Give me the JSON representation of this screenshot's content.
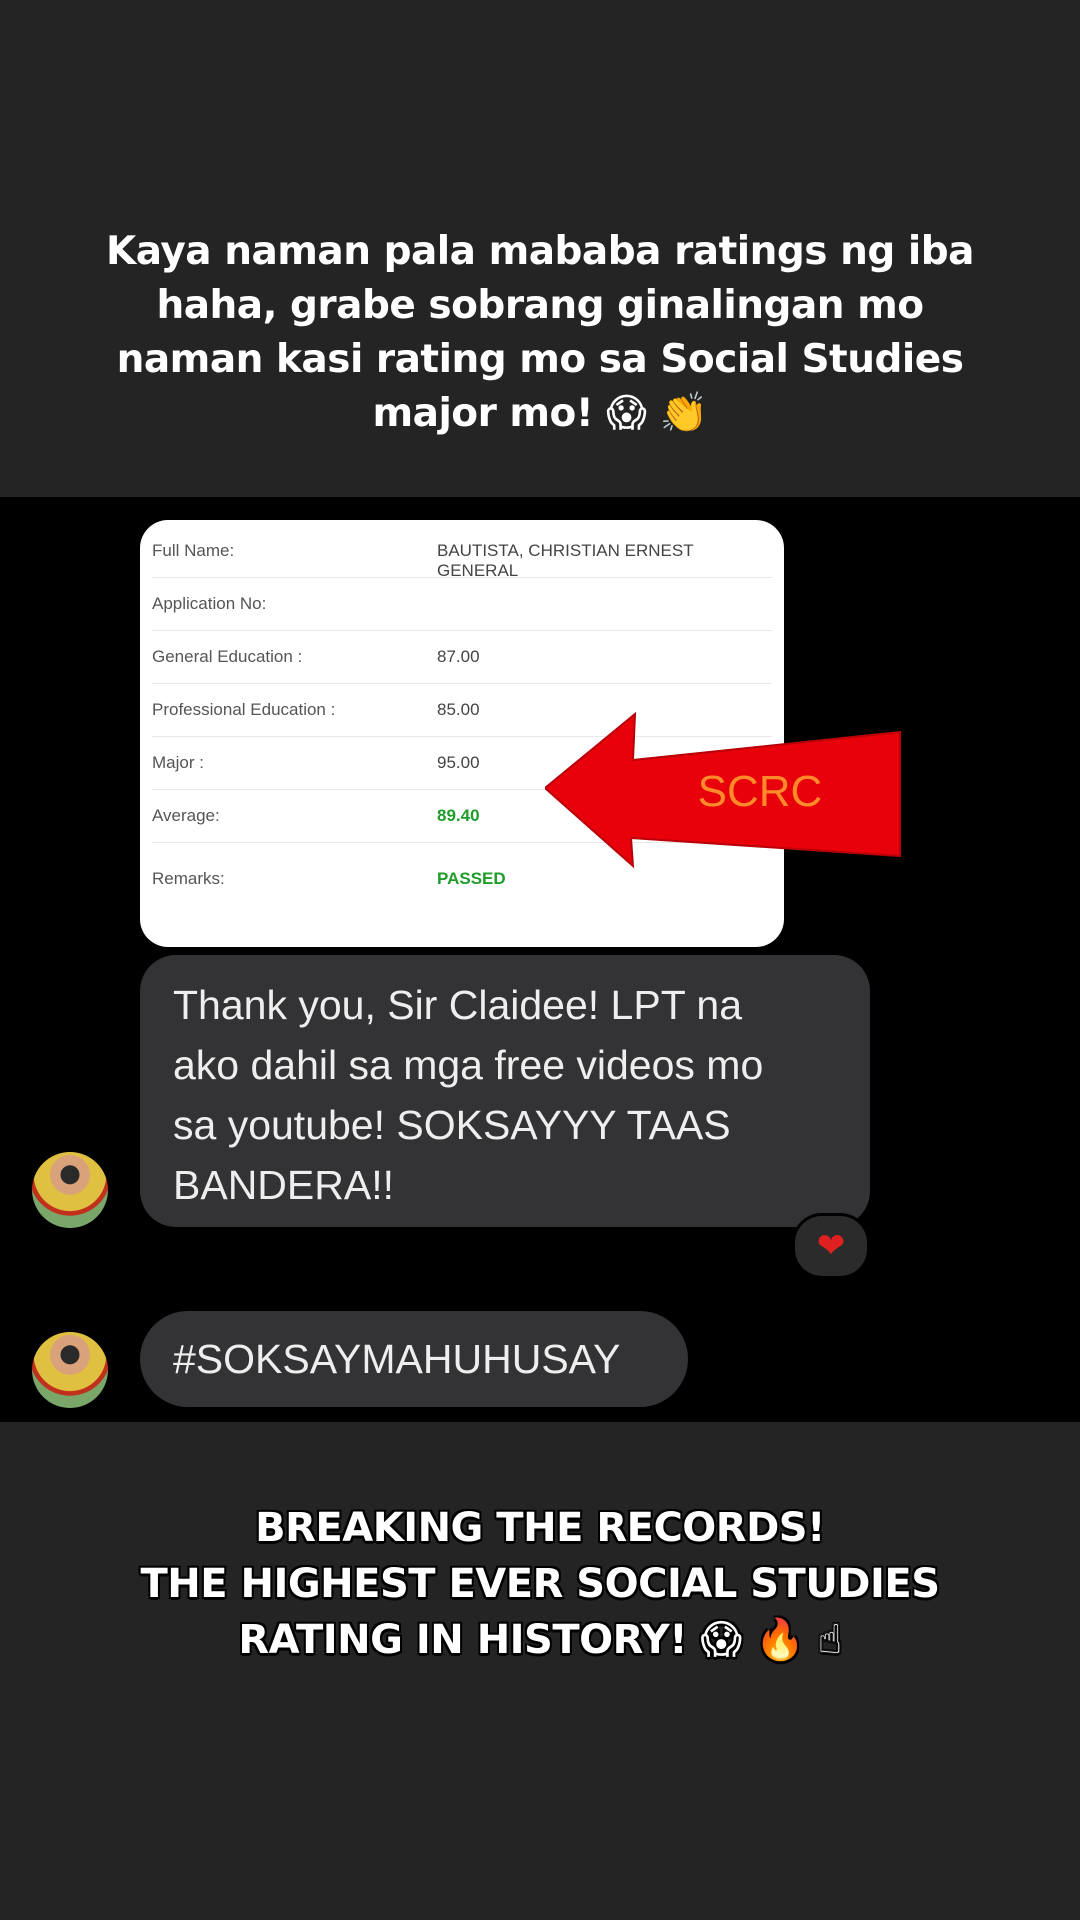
{
  "top_caption": {
    "line1": "Kaya naman pala mababa ratings ng iba",
    "line2": "haha, grabe sobrang ginalingan mo",
    "line3": "naman kasi rating mo sa Social Studies",
    "line4": "major mo! 😱 👏"
  },
  "result_card": {
    "rows": [
      {
        "label": "Full Name:",
        "value": "BAUTISTA, CHRISTIAN ERNEST GENERAL"
      },
      {
        "label": "Application No:",
        "value": ""
      },
      {
        "label": "General Education :",
        "value": "87.00"
      },
      {
        "label": "Professional Education :",
        "value": "85.00"
      },
      {
        "label": "Major :",
        "value": "95.00"
      },
      {
        "label": "Average:",
        "value": "89.40"
      },
      {
        "label": "Remarks:",
        "value": "PASSED"
      }
    ]
  },
  "arrow_label": "SCRC",
  "messages": [
    {
      "line1": "Thank you, Sir Claidee! LPT na",
      "line2": "ako dahil sa mga free videos mo",
      "line3": "sa youtube! SOKSAYYY TAAS",
      "line4": "BANDERA!!",
      "reaction": "❤"
    },
    {
      "text": "#SOKSAYMAHUHUSAY"
    }
  ],
  "bottom_caption": {
    "line1": "BREAKING THE RECORDS!",
    "line2": "THE HIGHEST EVER SOCIAL STUDIES",
    "line3": "RATING IN HISTORY! 😱 🔥 ☝"
  },
  "colors": {
    "background": "#242424",
    "chat_background": "#000000",
    "bubble": "#333335",
    "arrow": "#e8000a",
    "arrow_text": "#ff8a2a",
    "passed_green": "#1f9d2a"
  }
}
